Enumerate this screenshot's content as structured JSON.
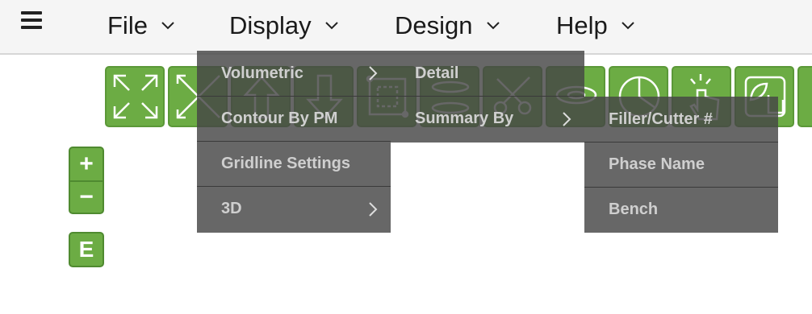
{
  "menubar": {
    "items": [
      {
        "label": "File"
      },
      {
        "label": "Display"
      },
      {
        "label": "Design"
      },
      {
        "label": "Help"
      }
    ]
  },
  "toolbar": {
    "buttons": [
      {
        "icon": "expand-icon"
      },
      {
        "icon": "collapse-icon"
      },
      {
        "icon": "arrow-up-icon"
      },
      {
        "icon": "arrow-down-icon"
      },
      {
        "icon": "polygon-select-icon"
      },
      {
        "icon": "layers-icon"
      },
      {
        "icon": "scissors-icon"
      },
      {
        "icon": "ellipse-icon"
      },
      {
        "icon": "pie-slice-icon"
      },
      {
        "icon": "click-hand-icon"
      },
      {
        "icon": "leaf-hand-icon"
      }
    ]
  },
  "zoom": {
    "in_label": "+",
    "out_label": "−"
  },
  "e_button": {
    "label": "E"
  },
  "display_menu": {
    "items": [
      {
        "label": "Volumetric",
        "submenu": true
      },
      {
        "label": "Contour By PM",
        "submenu": false
      },
      {
        "label": "Gridline Settings",
        "submenu": false
      },
      {
        "label": "3D",
        "submenu": true
      }
    ]
  },
  "volumetric_menu": {
    "items": [
      {
        "label": "Detail",
        "submenu": false
      },
      {
        "label": "Summary By",
        "submenu": true
      }
    ]
  },
  "summary_menu": {
    "items": [
      {
        "label": "Filler/Cutter #"
      },
      {
        "label": "Phase Name"
      },
      {
        "label": "Bench"
      }
    ]
  },
  "colors": {
    "accent_green": "#6cac44",
    "menu_bg": "#464646",
    "menu_text": "#cfcfcf"
  }
}
